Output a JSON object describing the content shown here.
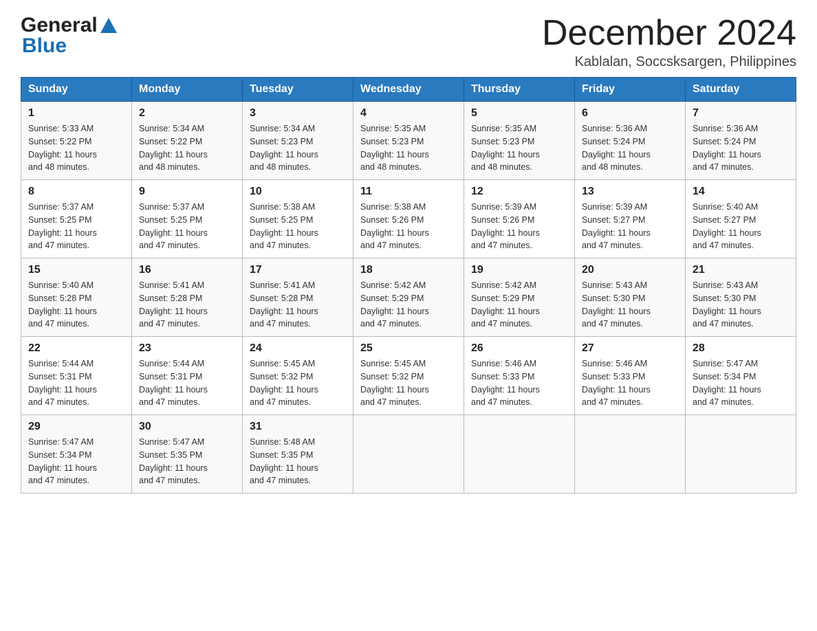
{
  "header": {
    "month_title": "December 2024",
    "subtitle": "Kablalan, Soccsksargen, Philippines"
  },
  "logo": {
    "general": "General",
    "blue": "Blue"
  },
  "days_of_week": [
    "Sunday",
    "Monday",
    "Tuesday",
    "Wednesday",
    "Thursday",
    "Friday",
    "Saturday"
  ],
  "weeks": [
    [
      {
        "day": "1",
        "sunrise": "5:33 AM",
        "sunset": "5:22 PM",
        "daylight": "11 hours and 48 minutes."
      },
      {
        "day": "2",
        "sunrise": "5:34 AM",
        "sunset": "5:22 PM",
        "daylight": "11 hours and 48 minutes."
      },
      {
        "day": "3",
        "sunrise": "5:34 AM",
        "sunset": "5:23 PM",
        "daylight": "11 hours and 48 minutes."
      },
      {
        "day": "4",
        "sunrise": "5:35 AM",
        "sunset": "5:23 PM",
        "daylight": "11 hours and 48 minutes."
      },
      {
        "day": "5",
        "sunrise": "5:35 AM",
        "sunset": "5:23 PM",
        "daylight": "11 hours and 48 minutes."
      },
      {
        "day": "6",
        "sunrise": "5:36 AM",
        "sunset": "5:24 PM",
        "daylight": "11 hours and 48 minutes."
      },
      {
        "day": "7",
        "sunrise": "5:36 AM",
        "sunset": "5:24 PM",
        "daylight": "11 hours and 47 minutes."
      }
    ],
    [
      {
        "day": "8",
        "sunrise": "5:37 AM",
        "sunset": "5:25 PM",
        "daylight": "11 hours and 47 minutes."
      },
      {
        "day": "9",
        "sunrise": "5:37 AM",
        "sunset": "5:25 PM",
        "daylight": "11 hours and 47 minutes."
      },
      {
        "day": "10",
        "sunrise": "5:38 AM",
        "sunset": "5:25 PM",
        "daylight": "11 hours and 47 minutes."
      },
      {
        "day": "11",
        "sunrise": "5:38 AM",
        "sunset": "5:26 PM",
        "daylight": "11 hours and 47 minutes."
      },
      {
        "day": "12",
        "sunrise": "5:39 AM",
        "sunset": "5:26 PM",
        "daylight": "11 hours and 47 minutes."
      },
      {
        "day": "13",
        "sunrise": "5:39 AM",
        "sunset": "5:27 PM",
        "daylight": "11 hours and 47 minutes."
      },
      {
        "day": "14",
        "sunrise": "5:40 AM",
        "sunset": "5:27 PM",
        "daylight": "11 hours and 47 minutes."
      }
    ],
    [
      {
        "day": "15",
        "sunrise": "5:40 AM",
        "sunset": "5:28 PM",
        "daylight": "11 hours and 47 minutes."
      },
      {
        "day": "16",
        "sunrise": "5:41 AM",
        "sunset": "5:28 PM",
        "daylight": "11 hours and 47 minutes."
      },
      {
        "day": "17",
        "sunrise": "5:41 AM",
        "sunset": "5:28 PM",
        "daylight": "11 hours and 47 minutes."
      },
      {
        "day": "18",
        "sunrise": "5:42 AM",
        "sunset": "5:29 PM",
        "daylight": "11 hours and 47 minutes."
      },
      {
        "day": "19",
        "sunrise": "5:42 AM",
        "sunset": "5:29 PM",
        "daylight": "11 hours and 47 minutes."
      },
      {
        "day": "20",
        "sunrise": "5:43 AM",
        "sunset": "5:30 PM",
        "daylight": "11 hours and 47 minutes."
      },
      {
        "day": "21",
        "sunrise": "5:43 AM",
        "sunset": "5:30 PM",
        "daylight": "11 hours and 47 minutes."
      }
    ],
    [
      {
        "day": "22",
        "sunrise": "5:44 AM",
        "sunset": "5:31 PM",
        "daylight": "11 hours and 47 minutes."
      },
      {
        "day": "23",
        "sunrise": "5:44 AM",
        "sunset": "5:31 PM",
        "daylight": "11 hours and 47 minutes."
      },
      {
        "day": "24",
        "sunrise": "5:45 AM",
        "sunset": "5:32 PM",
        "daylight": "11 hours and 47 minutes."
      },
      {
        "day": "25",
        "sunrise": "5:45 AM",
        "sunset": "5:32 PM",
        "daylight": "11 hours and 47 minutes."
      },
      {
        "day": "26",
        "sunrise": "5:46 AM",
        "sunset": "5:33 PM",
        "daylight": "11 hours and 47 minutes."
      },
      {
        "day": "27",
        "sunrise": "5:46 AM",
        "sunset": "5:33 PM",
        "daylight": "11 hours and 47 minutes."
      },
      {
        "day": "28",
        "sunrise": "5:47 AM",
        "sunset": "5:34 PM",
        "daylight": "11 hours and 47 minutes."
      }
    ],
    [
      {
        "day": "29",
        "sunrise": "5:47 AM",
        "sunset": "5:34 PM",
        "daylight": "11 hours and 47 minutes."
      },
      {
        "day": "30",
        "sunrise": "5:47 AM",
        "sunset": "5:35 PM",
        "daylight": "11 hours and 47 minutes."
      },
      {
        "day": "31",
        "sunrise": "5:48 AM",
        "sunset": "5:35 PM",
        "daylight": "11 hours and 47 minutes."
      },
      null,
      null,
      null,
      null
    ]
  ],
  "labels": {
    "sunrise": "Sunrise:",
    "sunset": "Sunset:",
    "daylight": "Daylight:"
  }
}
